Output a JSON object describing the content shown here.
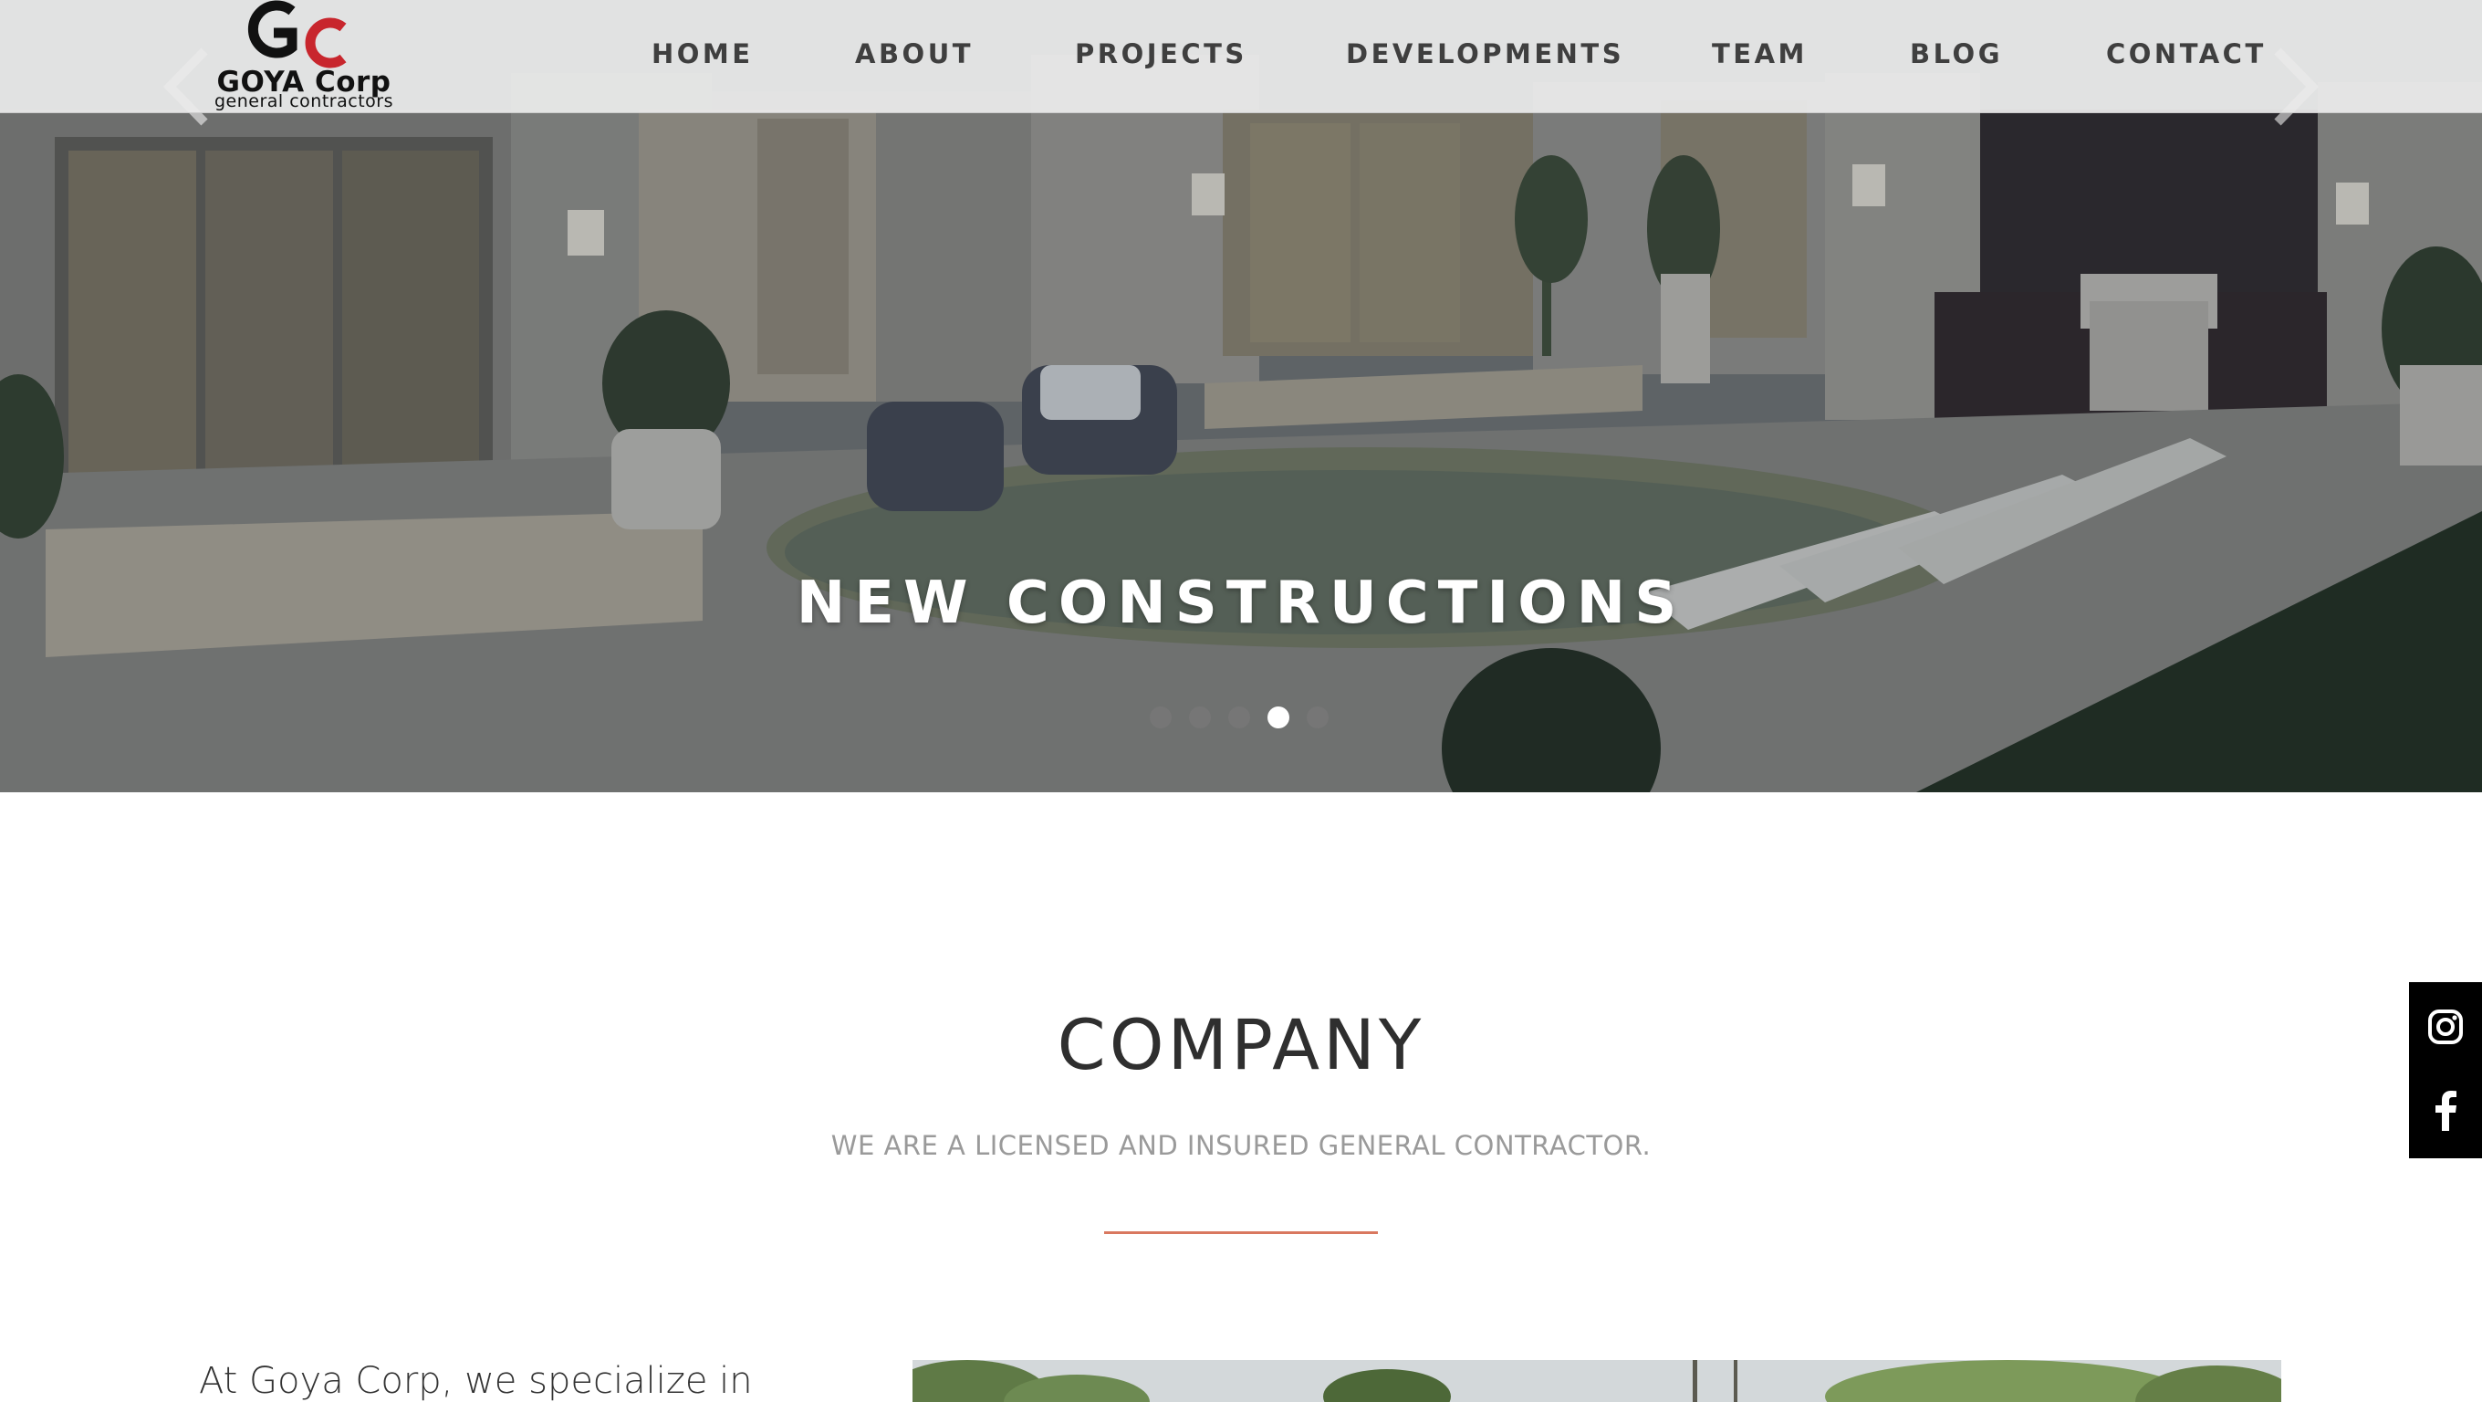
{
  "brand": {
    "logo_name": "GOYA Corp",
    "logo_tagline": "general contractors",
    "logo_letters": "GC",
    "colors": {
      "logo_red": "#c8262d",
      "logo_black": "#111111",
      "accent_divider": "#d9785f"
    }
  },
  "nav": {
    "items": [
      {
        "label": "HOME"
      },
      {
        "label": "ABOUT"
      },
      {
        "label": "PROJECTS"
      },
      {
        "label": "DEVELOPMENTS"
      },
      {
        "label": "TEAM"
      },
      {
        "label": "BLOG"
      },
      {
        "label": "CONTACT"
      }
    ]
  },
  "hero": {
    "title": "NEW CONSTRUCTIONS",
    "slide_count": 5,
    "active_slide": 4,
    "prev_icon": "chevron-left-icon",
    "next_icon": "chevron-right-icon"
  },
  "social": {
    "items": [
      {
        "icon": "instagram-icon"
      },
      {
        "icon": "facebook-icon"
      }
    ]
  },
  "company": {
    "title": "COMPANY",
    "subtitle": "WE ARE A LICENSED AND INSURED GENERAL CONTRACTOR.",
    "intro": "At Goya Corp, we specialize in"
  }
}
